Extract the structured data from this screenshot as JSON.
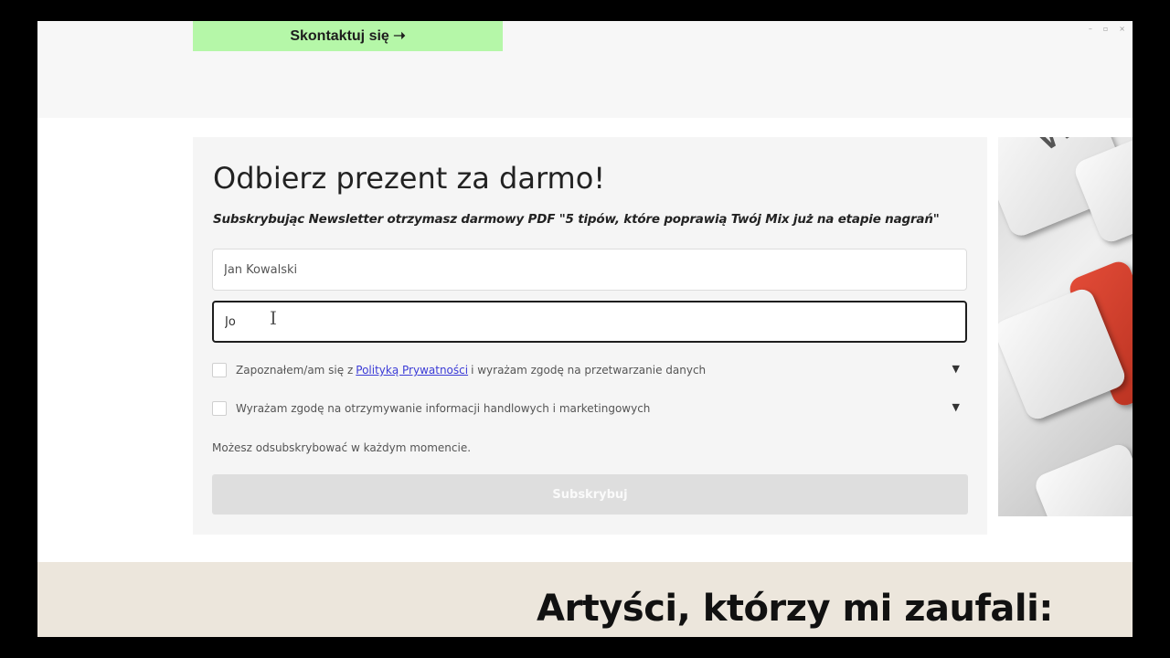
{
  "header": {
    "contact_button_label": "Skontaktuj się ➝",
    "window_controls": [
      "–",
      "▫",
      "×"
    ]
  },
  "form": {
    "title": "Odbierz prezent za darmo!",
    "subtitle": "Subskrybując Newsletter otrzymasz darmowy PDF \"5 tipów, które poprawią Twój Mix już na etapie nagrań\"",
    "name_input": {
      "value": "Jan Kowalski",
      "placeholder": ""
    },
    "email_input": {
      "value": "Jo",
      "placeholder": ""
    },
    "consent_privacy": {
      "checked": false,
      "text_before": "Zapoznałem/am się z",
      "link_text": "Polityką Prywatności",
      "text_after": "i wyrażam zgodę na przetwarzanie danych"
    },
    "consent_marketing": {
      "checked": false,
      "text": "Wyrażam zgodę na otrzymywanie informacji handlowych i marketingowych"
    },
    "expand_icon": "▼",
    "unsubscribe_note": "Możesz odsubskrybować w każdym momencie.",
    "subscribe_label": "Subskrybuj"
  },
  "keyboard_image": {
    "key_letter": "W"
  },
  "artists_section": {
    "heading": "Artyści, którzy mi zaufali:"
  },
  "colors": {
    "contact_button": "#b5f7a8",
    "link": "#3b3bd6",
    "subscribe_disabled": "#dedede",
    "artists_background": "#ece6dc"
  }
}
